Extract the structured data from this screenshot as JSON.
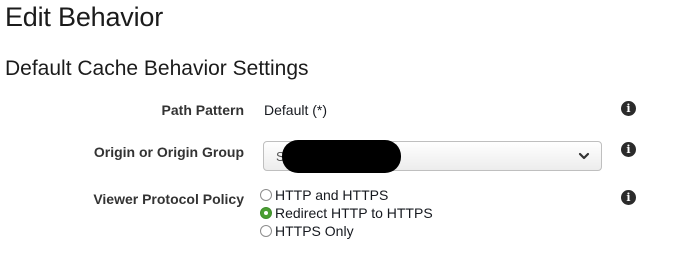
{
  "page": {
    "title": "Edit Behavior"
  },
  "section": {
    "title": "Default Cache Behavior Settings"
  },
  "fields": {
    "path_pattern": {
      "label": "Path Pattern",
      "value": "Default (*)",
      "info_icon": "info-icon"
    },
    "origin": {
      "label": "Origin or Origin Group",
      "selected_value": "S3",
      "redacted": true,
      "info_icon": "info-icon"
    },
    "viewer_protocol_policy": {
      "label": "Viewer Protocol Policy",
      "options": [
        {
          "label": "HTTP and HTTPS",
          "checked": false
        },
        {
          "label": "Redirect HTTP to HTTPS",
          "checked": true
        },
        {
          "label": "HTTPS Only",
          "checked": false
        }
      ],
      "info_icon": "info-icon"
    }
  },
  "colors": {
    "radio_checked": "#4a9e32",
    "info_icon_bg": "#2b2b2b",
    "redaction": "#000000"
  }
}
